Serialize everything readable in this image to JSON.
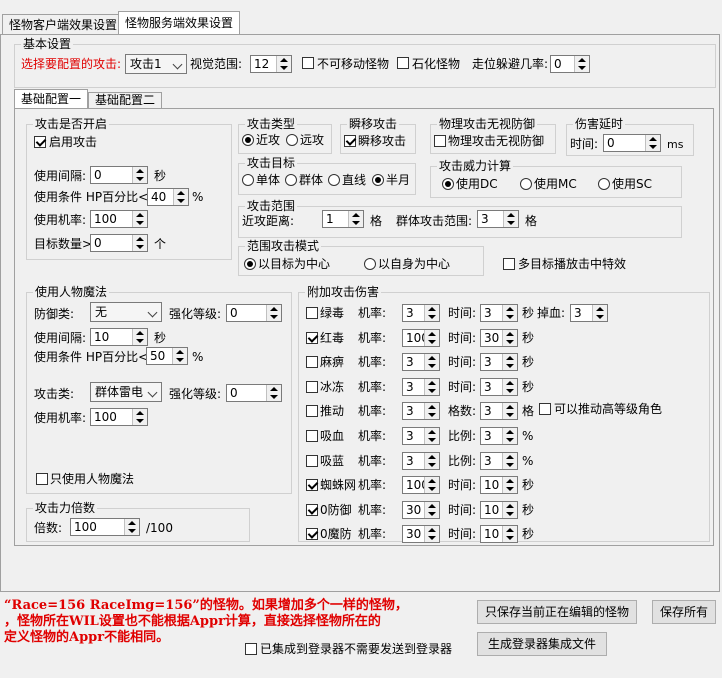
{
  "tabs": {
    "client": "怪物客户端效果设置",
    "server": "怪物服务端效果设置"
  },
  "basic": {
    "title": "基本设置",
    "select_label": "选择要配置的攻击:",
    "attack_select": "攻击1",
    "view_range_label": "视觉范围:",
    "view_range": "12",
    "immovable": "不可移动怪物",
    "petrify": "石化怪物",
    "dodge_label": "走位躲避几率:",
    "dodge": "0"
  },
  "subtabs": {
    "one": "基础配置一",
    "two": "基础配置二"
  },
  "attack_enabled": {
    "title": "攻击是否开启",
    "enable": "启用攻击",
    "interval_label": "使用间隔:",
    "interval": "0",
    "interval_unit": "秒",
    "hp_label": "使用条件 HP百分比<",
    "hp": "40",
    "hp_unit": "%",
    "rate_label": "使用机率:",
    "rate": "100",
    "target_label": "目标数量>",
    "target": "0",
    "target_unit": "个"
  },
  "attack_type": {
    "title": "攻击类型",
    "near": "近攻",
    "far": "远攻"
  },
  "teleport": {
    "title": "瞬移攻击",
    "label": "瞬移攻击"
  },
  "ignore_def": {
    "title": "物理攻击无视防御",
    "label": "物理攻击无视防御"
  },
  "delay": {
    "title": "伤害延时",
    "label": "时间:",
    "value": "0",
    "unit": "ms"
  },
  "target": {
    "title": "攻击目标",
    "single": "单体",
    "group": "群体",
    "line": "直线",
    "half": "半月"
  },
  "power": {
    "title": "攻击威力计算",
    "dc": "使用DC",
    "mc": "使用MC",
    "sc": "使用SC"
  },
  "range": {
    "title": "攻击范围",
    "near_label": "近攻距离:",
    "near": "1",
    "near_unit": "格",
    "group_label": "群体攻击范围:",
    "group": "3",
    "group_unit": "格"
  },
  "mode": {
    "title": "范围攻击模式",
    "target_center": "以目标为中心",
    "self_center": "以自身为中心"
  },
  "multi_effect": "多目标播放击中特效",
  "magic": {
    "title": "使用人物魔法",
    "def_label": "防御类:",
    "def_value": "无",
    "strength_label": "强化等级:",
    "def_strength": "0",
    "interval_label": "使用间隔:",
    "interval": "10",
    "interval_unit": "秒",
    "hp_label": "使用条件 HP百分比<",
    "hp": "50",
    "hp_unit": "%",
    "atk_label": "攻击类:",
    "atk_value": "群体雷电",
    "atk_strength": "0",
    "rate_label": "使用机率:",
    "rate": "100",
    "only": "只使用人物魔法"
  },
  "multiplier": {
    "title": "攻击力倍数",
    "label": "倍数:",
    "value": "100",
    "unit": "/100"
  },
  "extra": {
    "title": "附加攻击伤害",
    "rate_label": "机率:",
    "rows": [
      {
        "name": "绿毒",
        "checked": false,
        "rate": "3",
        "l2": "时间:",
        "v2": "3",
        "u2": "秒",
        "l3": "掉血:",
        "v3": "3"
      },
      {
        "name": "红毒",
        "checked": true,
        "rate": "100",
        "l2": "时间:",
        "v2": "30",
        "u2": "秒"
      },
      {
        "name": "麻痹",
        "checked": false,
        "rate": "3",
        "l2": "时间:",
        "v2": "3",
        "u2": "秒"
      },
      {
        "name": "冰冻",
        "checked": false,
        "rate": "3",
        "l2": "时间:",
        "v2": "3",
        "u2": "秒"
      },
      {
        "name": "推动",
        "checked": false,
        "rate": "3",
        "l2": "格数:",
        "v2": "3",
        "u2": "格",
        "extra_check": "可以推动高等级角色"
      },
      {
        "name": "吸血",
        "checked": false,
        "rate": "3",
        "l2": "比例:",
        "v2": "3",
        "u2": "%"
      },
      {
        "name": "吸蓝",
        "checked": false,
        "rate": "3",
        "l2": "比例:",
        "v2": "3",
        "u2": "%"
      },
      {
        "name": "蜘蛛网",
        "checked": true,
        "rate": "100",
        "l2": "时间:",
        "v2": "10",
        "u2": "秒"
      },
      {
        "name": "0防御",
        "checked": true,
        "rate": "30",
        "l2": "时间:",
        "v2": "10",
        "u2": "秒"
      },
      {
        "name": "0魔防",
        "checked": true,
        "rate": "30",
        "l2": "时间:",
        "v2": "10",
        "u2": "秒"
      }
    ]
  },
  "message": {
    "line1": "“Race=156 RaceImg=156”的怪物。如果增加多个一样的怪物，",
    "line2": "，怪物所在WIL设置也不能根据Appr计算，直接选择怪物所在的",
    "line3": "定义怪物的Appr不能相同。"
  },
  "buttons": {
    "save_current": "只保存当前正在编辑的怪物",
    "save_all": "保存所有",
    "gen_file": "生成登录器集成文件"
  },
  "integrated": "已集成到登录器不需要发送到登录器"
}
